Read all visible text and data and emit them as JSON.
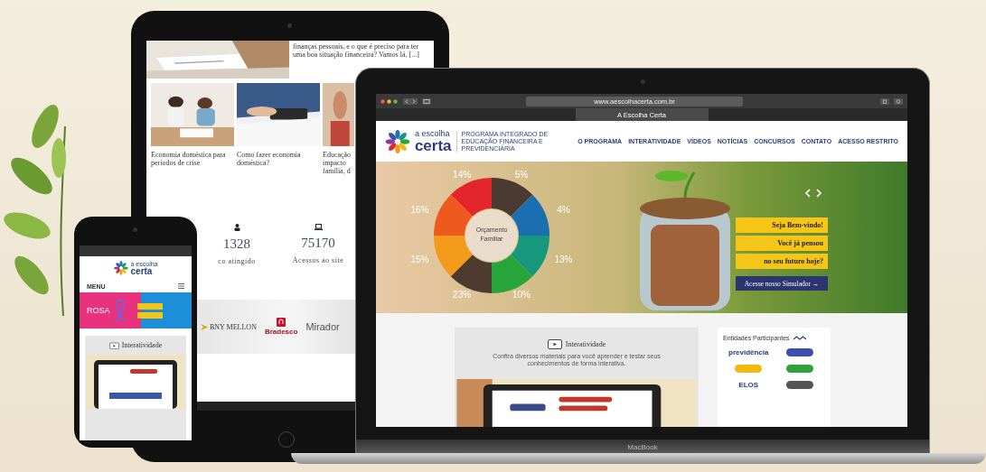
{
  "tablet": {
    "excerpt": "finanças pessoais, e o que é preciso para ter uma boa situação financeira? Vamos lá. [...]",
    "articles": [
      {
        "caption": "Economia doméstica para períodos de crise"
      },
      {
        "caption": "Como fazer economia doméstica?"
      },
      {
        "caption": "Educação impacto família, d"
      }
    ],
    "stats": [
      {
        "kind": "person",
        "value": "1328",
        "label": "co atingido"
      },
      {
        "kind": "laptop",
        "value": "75170",
        "label": "Acessos ao site"
      }
    ],
    "partners": [
      {
        "kind": "bny",
        "name": "BNY MELLON"
      },
      {
        "kind": "bradesco",
        "name": "Bradesco"
      },
      {
        "kind": "mirador",
        "name": "Mirador"
      }
    ]
  },
  "laptop": {
    "browser": {
      "url": "www.aescolhacerta.com.br",
      "tabs": [
        {
          "label": "A Escolha Certa",
          "selected": true
        }
      ]
    },
    "logo": {
      "top": "a escolha",
      "bottom": "certa",
      "tagline": "PROGRAMA INTEGRADO DE EDUCAÇÃO FINANCEIRA E PREVIDENCIÁRIA"
    },
    "nav": [
      "O PROGRAMA",
      "INTERATIVIDADE",
      "VÍDEOS",
      "NOTÍCIAS",
      "CONCURSOS",
      "CONTATO",
      "ACESSO RESTRITO"
    ],
    "hero": {
      "donut_center": [
        "Orçamento",
        "Familiar"
      ],
      "segments": [
        {
          "label": "14%",
          "color": "#e3262b"
        },
        {
          "label": "5%",
          "color": "#4a3a30"
        },
        {
          "label": "4%",
          "color": "#1b6fb0"
        },
        {
          "label": "13%",
          "color": "#17977e"
        },
        {
          "label": "10%",
          "color": "#27a53a"
        },
        {
          "label": "23%",
          "color": "#4d3b2f"
        },
        {
          "label": "15%",
          "color": "#f39a1b"
        },
        {
          "label": "16%",
          "color": "#ee5a1e"
        }
      ],
      "callouts": [
        "Seja Bem-vindo!",
        "Você já pensou",
        "no seu futuro hoje?"
      ],
      "cta": "Acesse nosso Simulador →"
    },
    "interactive": {
      "title": "Interatividade",
      "description": "Confira diversos materiais para você aprender e testar seus conhecimentos de forma interativa."
    },
    "partners": {
      "title": "Entidades Participantes",
      "logos": [
        {
          "kind": "text",
          "name": "previdência"
        },
        {
          "kind": "mark",
          "color": "#3b4fb0"
        },
        {
          "kind": "mark",
          "color": "#f2b90f"
        },
        {
          "kind": "mark",
          "color": "#2fa33a"
        },
        {
          "kind": "text",
          "name": "ELOS"
        },
        {
          "kind": "mark",
          "color": "#555555"
        }
      ]
    },
    "brand": "MacBook"
  },
  "phone": {
    "logo_top": "a escolha",
    "logo_bottom": "certa",
    "menu": "MENU",
    "banner": "ROSA",
    "section": "Interatividade"
  }
}
